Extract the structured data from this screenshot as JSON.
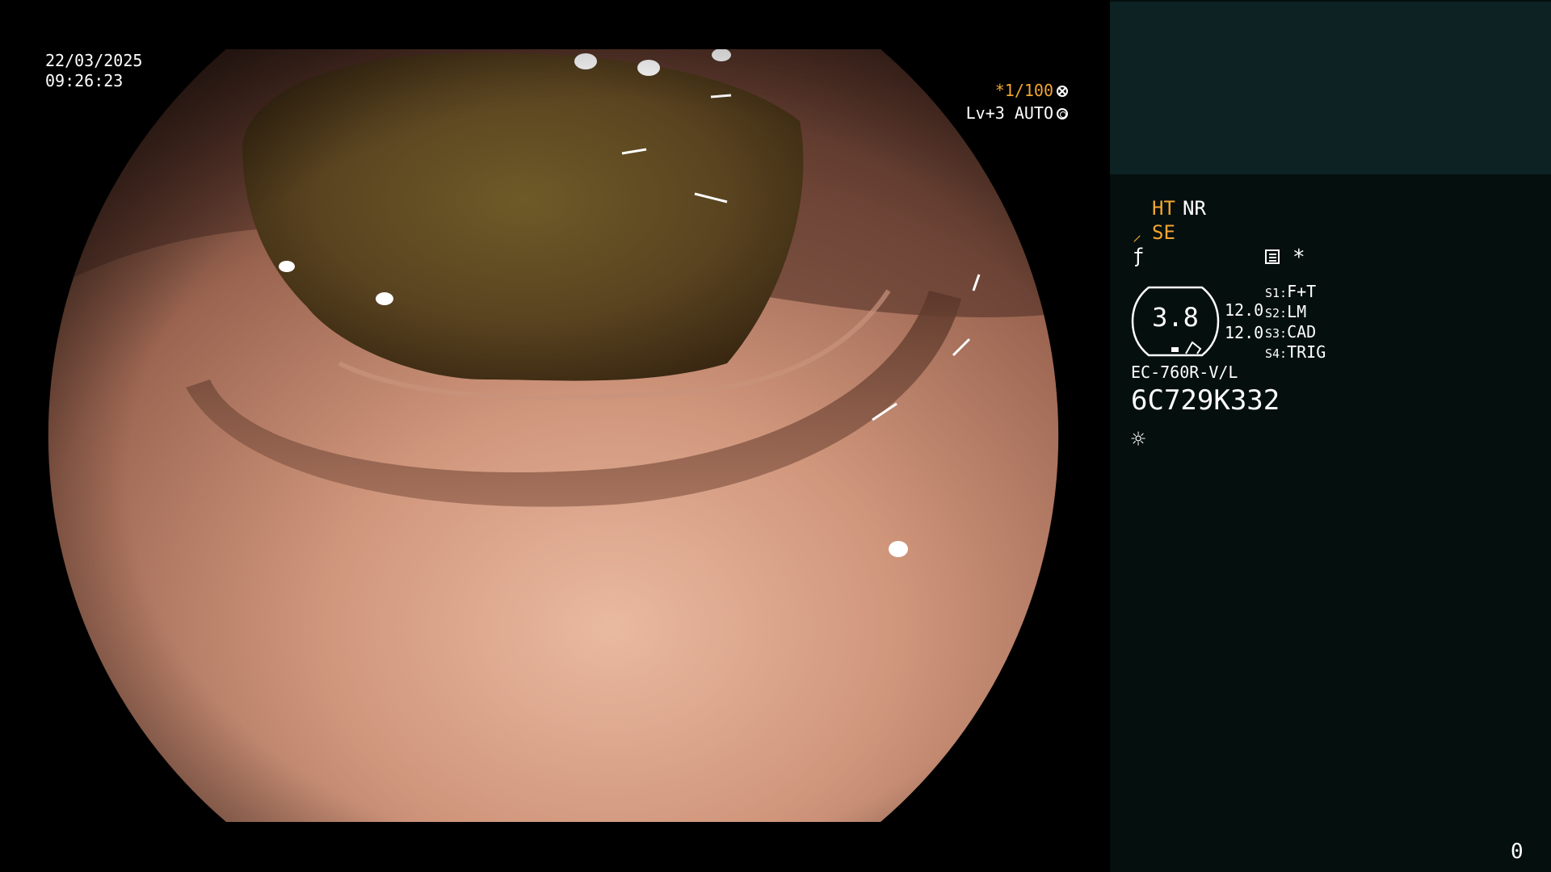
{
  "overlay": {
    "date": "22/03/2025",
    "time": "09:26:23",
    "shutter": "*1/100",
    "shutter_icon": "shutter-cross-icon",
    "iris_level": "Lv+3",
    "iris_mode": "AUTO",
    "iris_icon": "iris-ring-icon"
  },
  "panel": {
    "enhance_label": "HT",
    "noise_label": "NR",
    "structure_icon": "structure-enhance-icon",
    "structure_label": "SE",
    "wave_icon": "f-wave-icon",
    "menu_icon": "list-icon",
    "star": "*",
    "gauge_value": "3.8",
    "value_a": "12.0",
    "value_b": "12.0",
    "switches": [
      {
        "key": "S1:",
        "value": "F+T"
      },
      {
        "key": "S2:",
        "value": "LM"
      },
      {
        "key": "S3:",
        "value": "CAD"
      },
      {
        "key": "S4:",
        "value": "TRIG"
      }
    ],
    "scope_model": "EC-760R-V/L",
    "serial_number": "6C729K332",
    "light_icon": "sun-icon",
    "counter": "0"
  },
  "colors": {
    "accent_orange": "#f2a531",
    "panel_bg": "#050f0e",
    "panel_top_bg": "#0d2222",
    "text": "#ffffff"
  }
}
